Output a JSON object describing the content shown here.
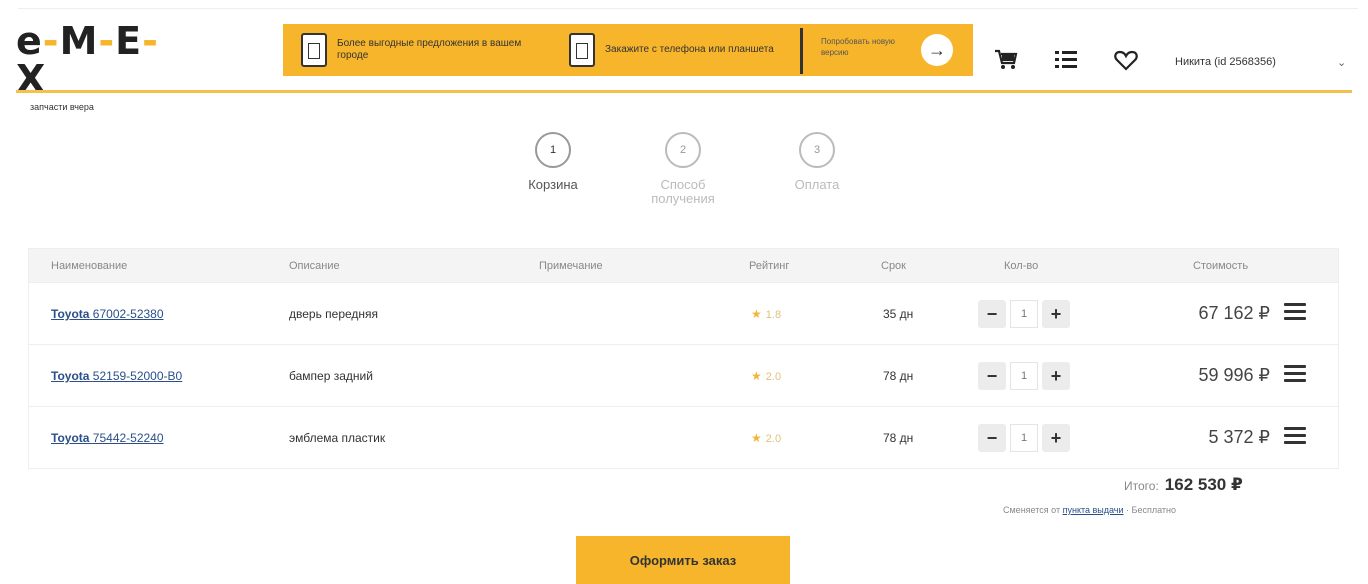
{
  "header": {
    "logo_text": "EMEX",
    "logo_sub": "запчасти вчера",
    "promo_1": "Более выгодные предложения в вашем городе",
    "promo_2": "Закажите с телефона или планшета",
    "promo_cta": "Попробовать новую версию",
    "user": "Никита (id 2568356)"
  },
  "stepper": [
    {
      "num": "1",
      "label": "Корзина"
    },
    {
      "num": "2",
      "label": "Способ получения"
    },
    {
      "num": "3",
      "label": "Оплата"
    }
  ],
  "table": {
    "headers": {
      "name": "Наименование",
      "desc": "Описание",
      "note": "Примечание",
      "rating": "Рейтинг",
      "term": "Срок",
      "qty": "Кол-во",
      "price": "Стоимость"
    },
    "rows": [
      {
        "brand": "Toyota",
        "code": "67002-52380",
        "desc": "дверь передняя",
        "rating": "1.8",
        "term": "35 дн",
        "qty": "1",
        "price": "67 162 ₽"
      },
      {
        "brand": "Toyota",
        "code": "52159-52000-B0",
        "desc": "бампер задний",
        "rating": "2.0",
        "term": "78 дн",
        "qty": "1",
        "price": "59 996 ₽"
      },
      {
        "brand": "Toyota",
        "code": "75442-52240",
        "desc": "эмблема пластик",
        "rating": "2.0",
        "term": "78 дн",
        "qty": "1",
        "price": "5 372 ₽"
      }
    ]
  },
  "summary": {
    "total_label": "Итого:",
    "total_value": "162 530 ₽",
    "note_prefix": "Сменяется от",
    "note_link": "пункта выдачи",
    "note_suffix": "· Бесплатно"
  },
  "order_button": "Оформить заказ",
  "colors": {
    "accent": "#f7b52c",
    "link": "#2a4f8a"
  }
}
